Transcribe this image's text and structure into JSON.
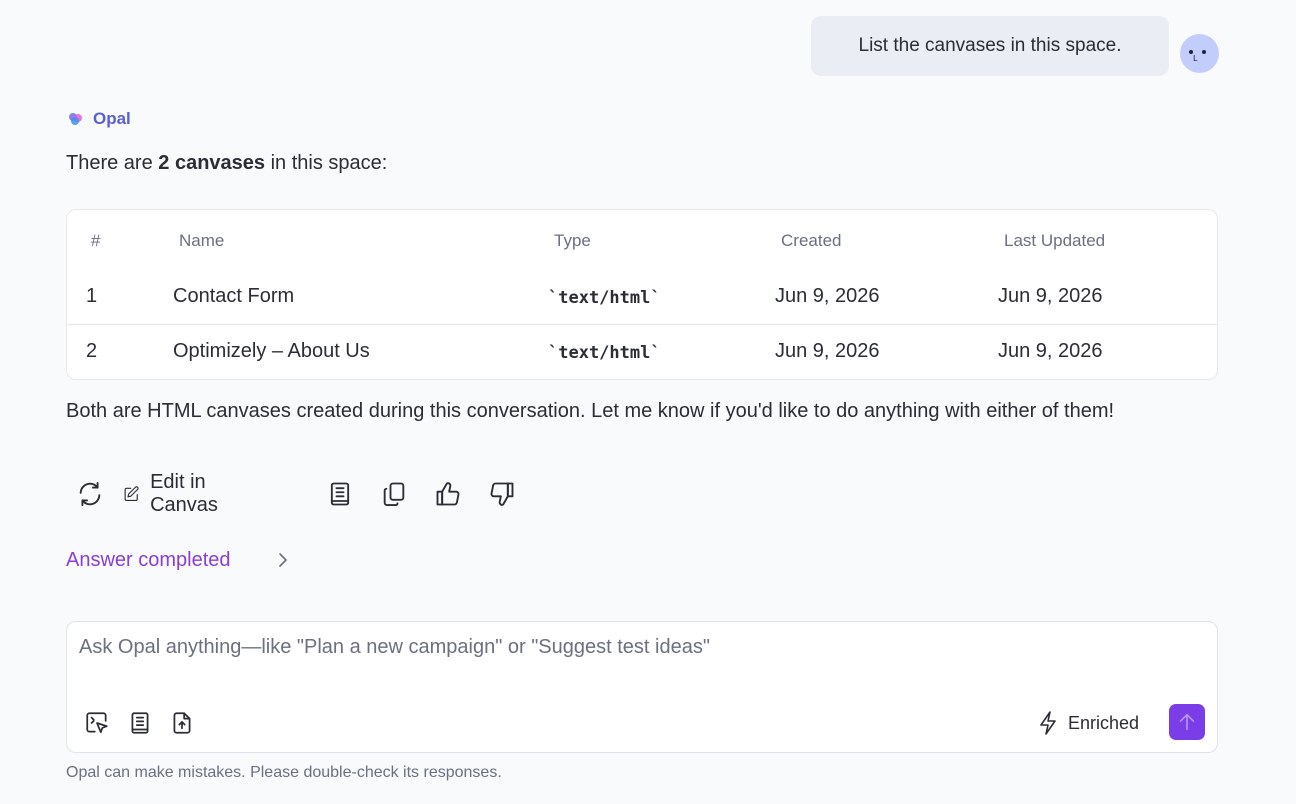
{
  "user_message": {
    "text": "List the canvases in this space."
  },
  "assistant": {
    "name": "Opal",
    "intro_prefix": "There are ",
    "intro_bold": "2 canvases",
    "intro_suffix": " in this space:",
    "table": {
      "headers": [
        "#",
        "Name",
        "Type",
        "Created",
        "Last Updated"
      ],
      "rows": [
        [
          "1",
          "Contact Form",
          "`text/html`",
          "Jun 9, 2026",
          "Jun 9, 2026"
        ],
        [
          "2",
          "Optimizely – About Us",
          "`text/html`",
          "Jun 9, 2026",
          "Jun 9, 2026"
        ]
      ]
    },
    "outro": "Both are HTML canvases created during this conversation. Let me know if you'd like to do anything with either of them!",
    "actions": {
      "regenerate_icon": "refresh-icon",
      "edit_label": "Edit in Canvas",
      "edit_icon": "pencil-square-icon",
      "save_icon": "notebook-icon",
      "copy_icon": "copy-icon",
      "like_icon": "thumbs-up-icon",
      "dislike_icon": "thumbs-down-icon"
    },
    "answer_status": "Answer completed"
  },
  "composer": {
    "placeholder": "Ask Opal anything—like \"Plan a new campaign\" or \"Suggest test ideas\"",
    "value": "",
    "tools": [
      "select-element-icon",
      "notebook-icon",
      "file-upload-icon"
    ],
    "mode_label": "Enriched",
    "mode_icon": "lightning-icon",
    "send_icon": "arrow-up-icon"
  },
  "disclaimer": "Opal can make mistakes. Please double-check its responses.",
  "colors": {
    "accent": "#7a3de8",
    "brand_label": "#5a5fd1",
    "answer_status": "#8a3ed6",
    "user_bubble": "#eaedf4",
    "avatar": "#c3cdfb",
    "background": "#f9fafc"
  }
}
